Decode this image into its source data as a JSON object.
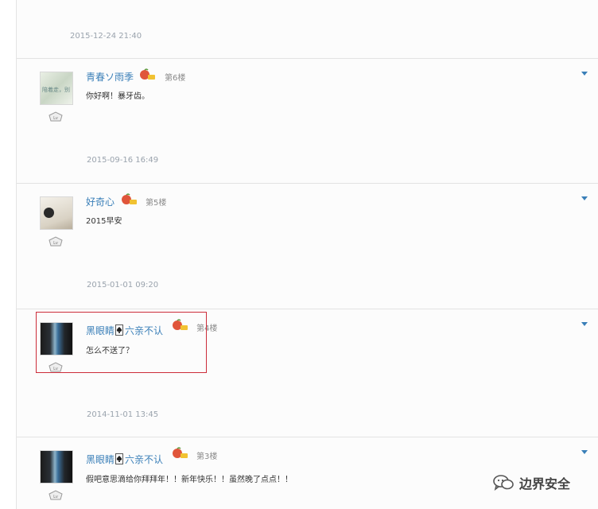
{
  "top_timestamp": "2015-12-24 21:40",
  "posts": [
    {
      "username": "青春ソ雨季",
      "floor": "第6楼",
      "message": "你好啊！暴牙齿。",
      "timestamp": "2015-09-16 16:49",
      "avatar_text": "陪着走，别"
    },
    {
      "username": "好奇心",
      "floor": "第5楼",
      "message": "2015早安",
      "timestamp": "2015-01-01 09:20"
    },
    {
      "username_part1": "黑眼睛",
      "username_part2": "六亲不认",
      "floor": "第4楼",
      "message": "怎么不送了？",
      "timestamp": "2014-11-01 13:45"
    },
    {
      "username_part1": "黑眼睛",
      "username_part2": "六亲不认",
      "floor": "第3楼",
      "message": "假吧意思滴给你拜拜年！！新年快乐！！虽然晚了点点！！"
    }
  ],
  "watermark": {
    "text": "边界安全",
    "icon": "wechat-icon"
  },
  "colors": {
    "username": "#3a7fb8",
    "timestamp": "#9aa3ad",
    "highlight": "#cc2d3a",
    "toggle": "#3a7fb8"
  }
}
